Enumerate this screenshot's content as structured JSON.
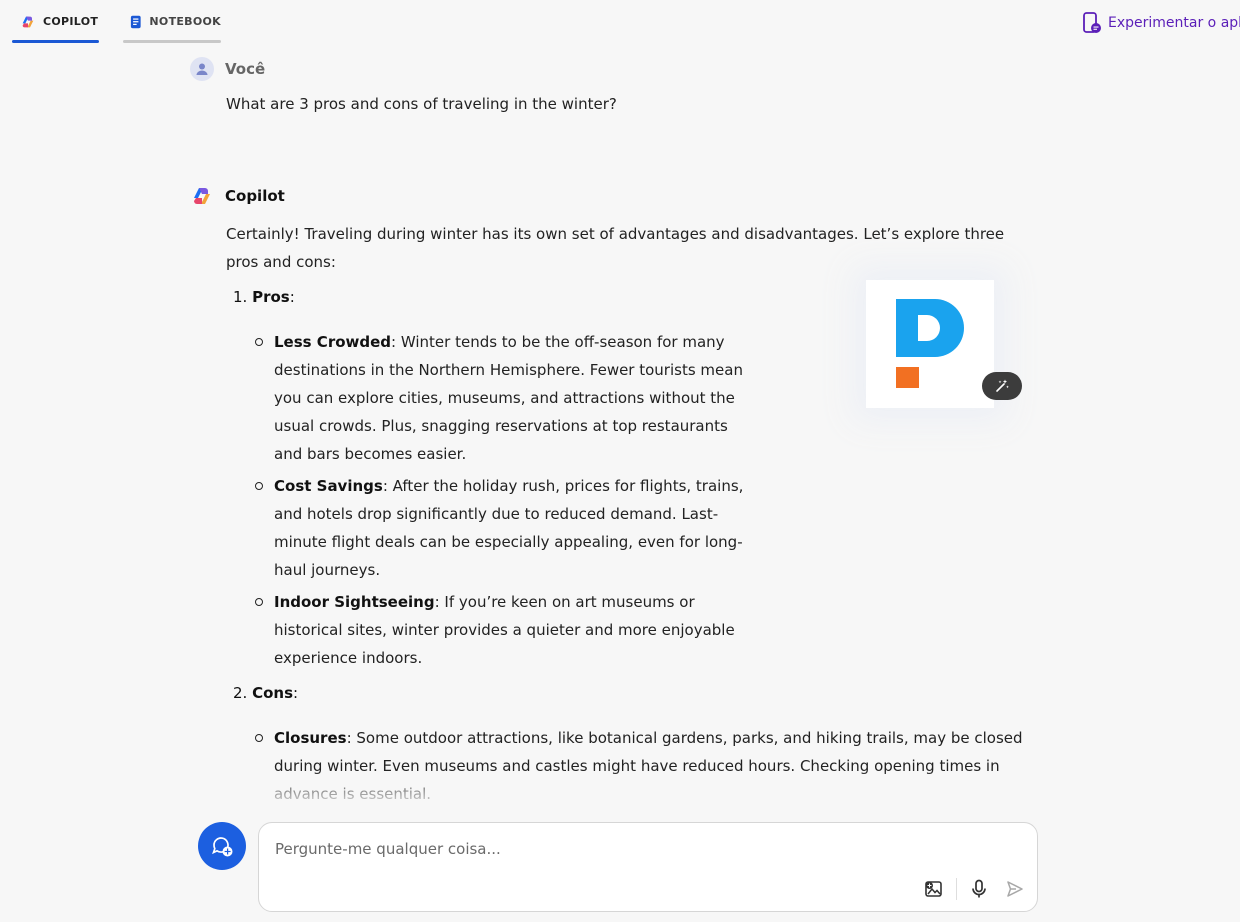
{
  "tabs": [
    {
      "label": "COPILOT",
      "active": true
    },
    {
      "label": "NOTEBOOK",
      "active": false
    }
  ],
  "app_link": {
    "label": "Experimentar o aplica"
  },
  "user_message": {
    "author": "Você",
    "text": "What are 3 pros and cons of traveling in the winter?"
  },
  "copilot_message": {
    "author": "Copilot",
    "intro": "Certainly! Traveling during winter has its own set of advantages and disadvantages. Let’s explore three pros and cons:",
    "sections": [
      {
        "number": "1.",
        "title": "Pros",
        "items": [
          {
            "title": "Less Crowded",
            "text": "Winter tends to be the off-season for many destinations in the Northern Hemisphere. Fewer tourists mean you can explore cities, museums, and attractions without the usual crowds. Plus, snagging reservations at top restaurants and bars becomes easier."
          },
          {
            "title": "Cost Savings",
            "text": "After the holiday rush, prices for flights, trains, and hotels drop significantly due to reduced demand. Last-minute flight deals can be especially appealing, even for long-haul journeys."
          },
          {
            "title": "Indoor Sightseeing",
            "text": "If you’re keen on art museums or historical sites, winter provides a quieter and more enjoyable experience indoors."
          }
        ]
      },
      {
        "number": "2.",
        "title": "Cons",
        "items": [
          {
            "title": "Closures",
            "text": "Some outdoor attractions, like botanical gardens, parks, and hiking trails, may be closed during winter. Even museums and castles might have reduced hours. Checking opening times in advance is essential."
          }
        ]
      }
    ]
  },
  "composer": {
    "placeholder": "Pergunte-me qualquer coisa..."
  },
  "colors": {
    "accent": "#1c5fe0",
    "app_link": "#5b1fb8",
    "logo_blue": "#1aa3ee",
    "logo_orange": "#f27022"
  },
  "icons": [
    "copilot-logo-icon",
    "notebook-icon",
    "phone-app-icon",
    "user-avatar-icon",
    "magic-wand-icon",
    "new-topic-icon",
    "image-add-icon",
    "microphone-icon",
    "send-icon"
  ]
}
